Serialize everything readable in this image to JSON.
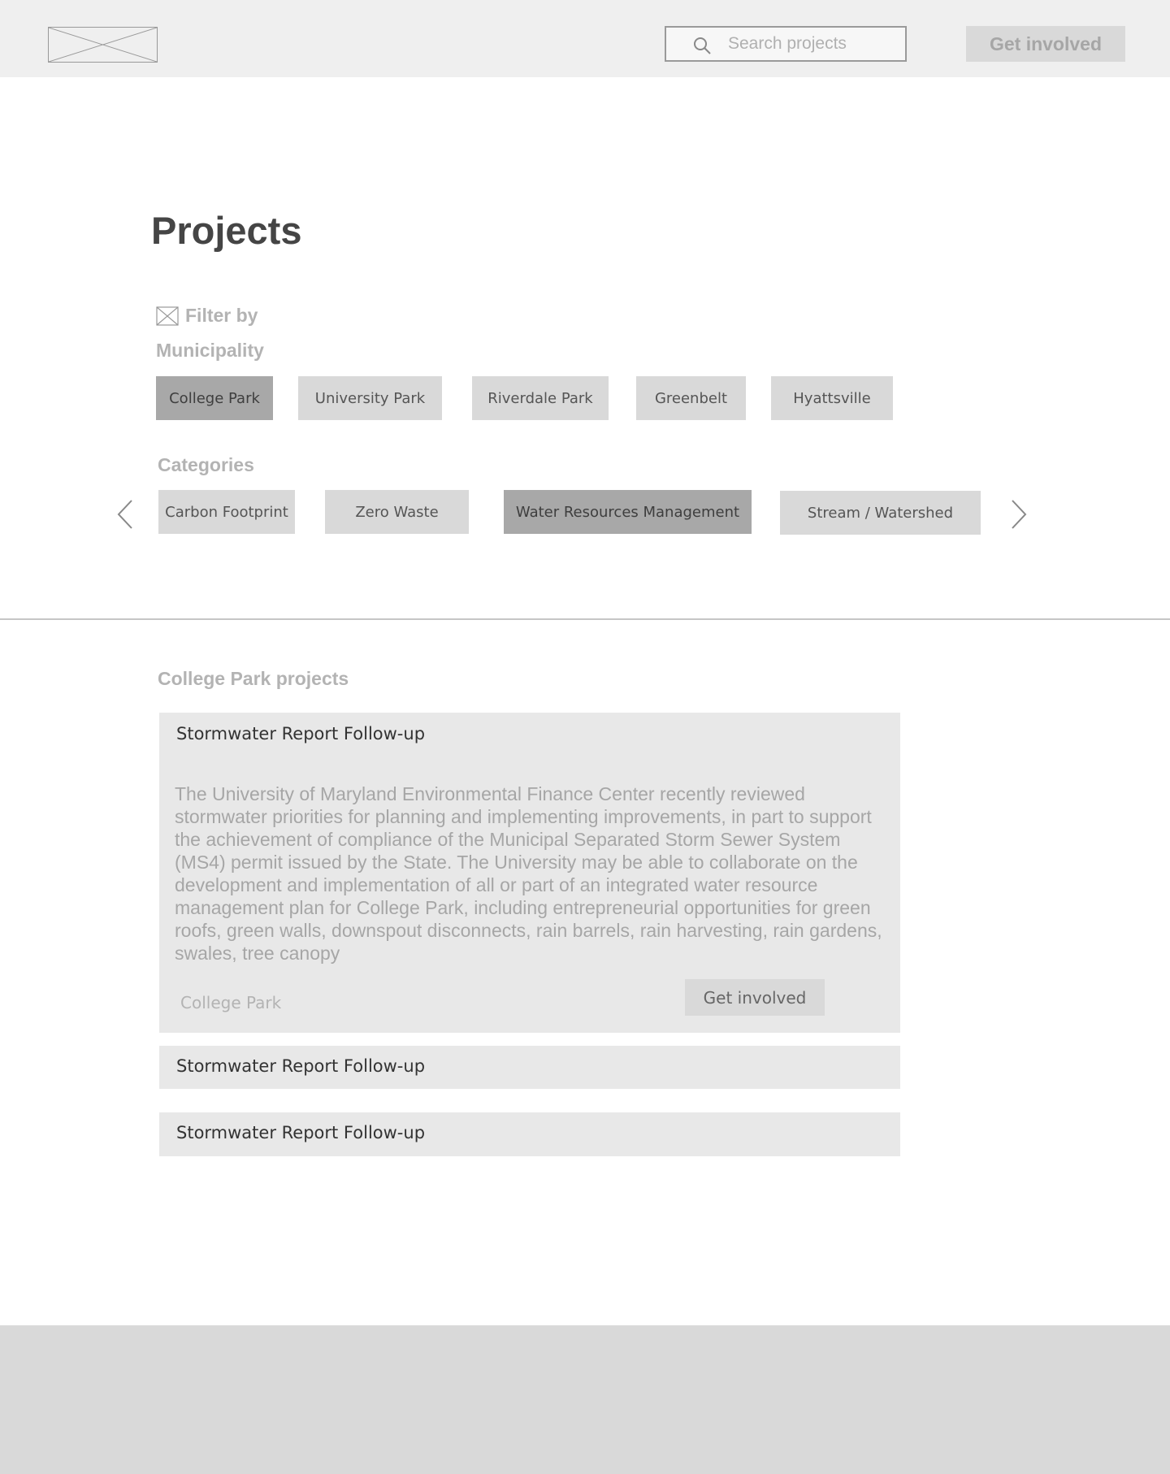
{
  "header": {
    "search": {
      "placeholder": "Search projects"
    },
    "cta_label": "Get involved"
  },
  "page": {
    "title": "Projects"
  },
  "filters": {
    "heading": "Filter by",
    "municipality": {
      "label": "Municipality",
      "options": [
        "College Park",
        "University Park",
        "Riverdale Park",
        "Greenbelt",
        "Hyattsville"
      ],
      "selected": "College Park"
    },
    "categories": {
      "label": "Categories",
      "options": [
        "Carbon Footprint",
        "Zero Waste",
        "Water Resources Management",
        "Stream / Watershed"
      ],
      "selected": "Water Resources Management"
    }
  },
  "results": {
    "title": "College Park projects",
    "projects": [
      {
        "title": "Stormwater Report Follow-up",
        "description": "The University of Maryland Environmental Finance Center recently reviewed stormwater priorities for planning and implementing improvements, in part to support the achievement of compliance of the Municipal Separated Storm Sewer System (MS4) permit issued by the State.  The University may be able to collaborate on the development and implementation of all or part of an integrated water resource management plan for College Park, including entrepreneurial opportunities for green roofs, green walls, downspout disconnects, rain barrels, rain harvesting, rain gardens, swales, tree canopy",
        "location": "College Park",
        "cta_label": "Get involved"
      },
      {
        "title": "Stormwater Report Follow-up"
      },
      {
        "title": "Stormwater Report Follow-up"
      }
    ]
  },
  "icons": {
    "logo": "image-placeholder-icon",
    "search": "search-icon",
    "filter": "filter-icon",
    "prev": "chevron-left-icon",
    "next": "chevron-right-icon"
  },
  "colors": {
    "header_bg": "#efefef",
    "chip_bg": "#d9d9d9",
    "chip_selected_bg": "#a8a8a8",
    "card_bg": "#e8e8e8",
    "footer_bg": "#d9d9d9"
  }
}
